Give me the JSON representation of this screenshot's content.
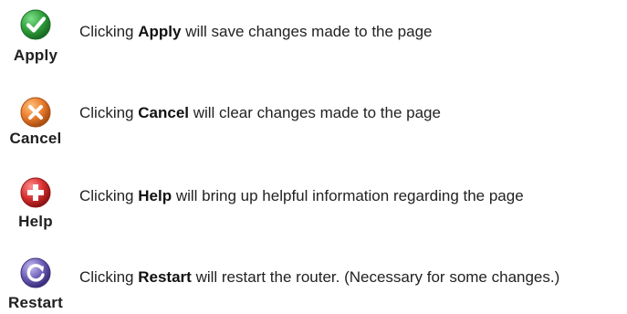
{
  "buttons": [
    {
      "id": "apply",
      "label": "Apply",
      "icon": "check-icon",
      "color": "#2e9e3a",
      "description_prefix": "Clicking ",
      "description_keyword": "Apply",
      "description_suffix": " will save changes made to the page"
    },
    {
      "id": "cancel",
      "label": "Cancel",
      "icon": "x-icon",
      "color": "#e8792a",
      "description_prefix": "Clicking ",
      "description_keyword": "Cancel",
      "description_suffix": " will clear changes made to the page"
    },
    {
      "id": "help",
      "label": "Help",
      "icon": "plus-icon",
      "color": "#d62e2e",
      "description_prefix": "Clicking ",
      "description_keyword": "Help",
      "description_suffix": " will bring up helpful information regarding the page"
    },
    {
      "id": "restart",
      "label": "Restart",
      "icon": "restart-icon",
      "color": "#6a5bb5",
      "description_prefix": "Clicking ",
      "description_keyword": "Restart",
      "description_suffix": " will restart the router.  (Necessary for some changes.)"
    }
  ]
}
